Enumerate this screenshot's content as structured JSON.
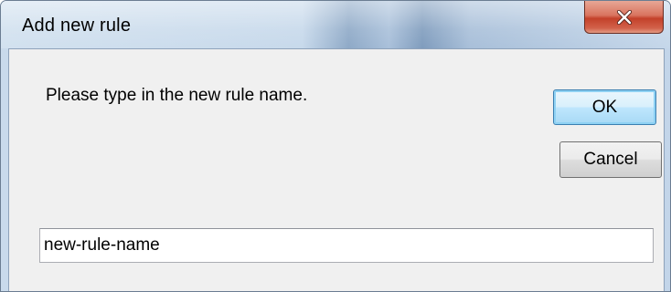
{
  "window": {
    "title": "Add new rule"
  },
  "titlebar": {
    "close_icon": "close-x-icon"
  },
  "dialog": {
    "prompt": "Please type in the new rule name.",
    "ok_label": "OK",
    "cancel_label": "Cancel",
    "input_value": "new-rule-name"
  },
  "colors": {
    "close_button": "#c3412a",
    "ok_button_focus": "#3c7fb1",
    "client_background": "#f0f0f0"
  }
}
